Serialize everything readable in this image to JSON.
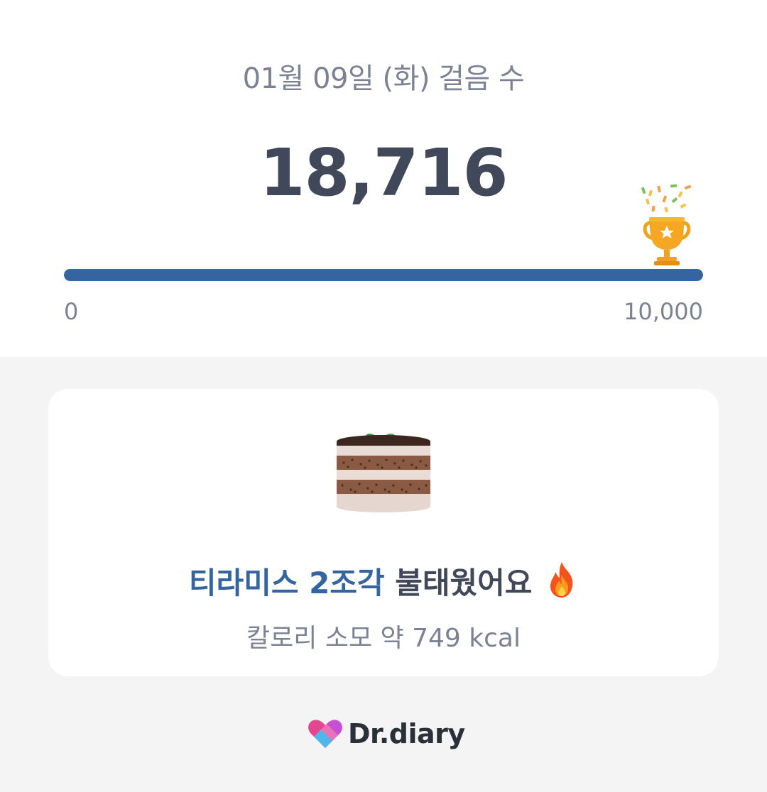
{
  "header": {
    "date_title": "01월 09일 (화) 걸음 수",
    "step_count": "18,716"
  },
  "progress": {
    "min_label": "0",
    "max_label": "10,000",
    "fraction": 1.0,
    "fill_color": "#35659f",
    "goal_icon": "trophy-icon"
  },
  "card": {
    "food_text": "티라미스 2조각",
    "burned_text": "불태웠어요",
    "burn_icon": "fire-icon",
    "food_icon": "tiramisu-cake-icon",
    "kcal_text": "칼로리 소모 약 749 kcal"
  },
  "brand": {
    "name": "Dr.diary",
    "logo_icon": "heart-logo-icon"
  }
}
